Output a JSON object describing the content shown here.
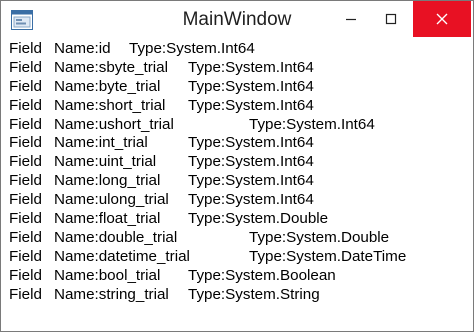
{
  "window": {
    "title": "MainWindow",
    "controls": {
      "minimize_icon": "minimize-icon",
      "maximize_icon": "maximize-icon",
      "close_icon": "close-icon"
    },
    "colors": {
      "close_button_bg": "#e81123",
      "title_text": "#1f1f1f",
      "content_text": "#000000"
    }
  },
  "fields": [
    {
      "kind": "Field",
      "name": "Name:id",
      "type": "Type:System.Int64"
    },
    {
      "kind": "Field",
      "name": "Name:sbyte_trial",
      "type": "Type:System.Int64"
    },
    {
      "kind": "Field",
      "name": "Name:byte_trial",
      "type": "Type:System.Int64"
    },
    {
      "kind": "Field",
      "name": "Name:short_trial",
      "type": "Type:System.Int64"
    },
    {
      "kind": "Field",
      "name": "Name:ushort_trial",
      "type": "Type:System.Int64"
    },
    {
      "kind": "Field",
      "name": "Name:int_trial",
      "type": "Type:System.Int64"
    },
    {
      "kind": "Field",
      "name": "Name:uint_trial",
      "type": "Type:System.Int64"
    },
    {
      "kind": "Field",
      "name": "Name:long_trial",
      "type": "Type:System.Int64"
    },
    {
      "kind": "Field",
      "name": "Name:ulong_trial",
      "type": "Type:System.Int64"
    },
    {
      "kind": "Field",
      "name": "Name:float_trial",
      "type": "Type:System.Double"
    },
    {
      "kind": "Field",
      "name": "Name:double_trial",
      "type": "Type:System.Double"
    },
    {
      "kind": "Field",
      "name": "Name:datetime_trial",
      "type": "Type:System.DateTime"
    },
    {
      "kind": "Field",
      "name": "Name:bool_trial",
      "type": "Type:System.Boolean"
    },
    {
      "kind": "Field",
      "name": "Name:string_trial",
      "type": "Type:System.String"
    }
  ]
}
